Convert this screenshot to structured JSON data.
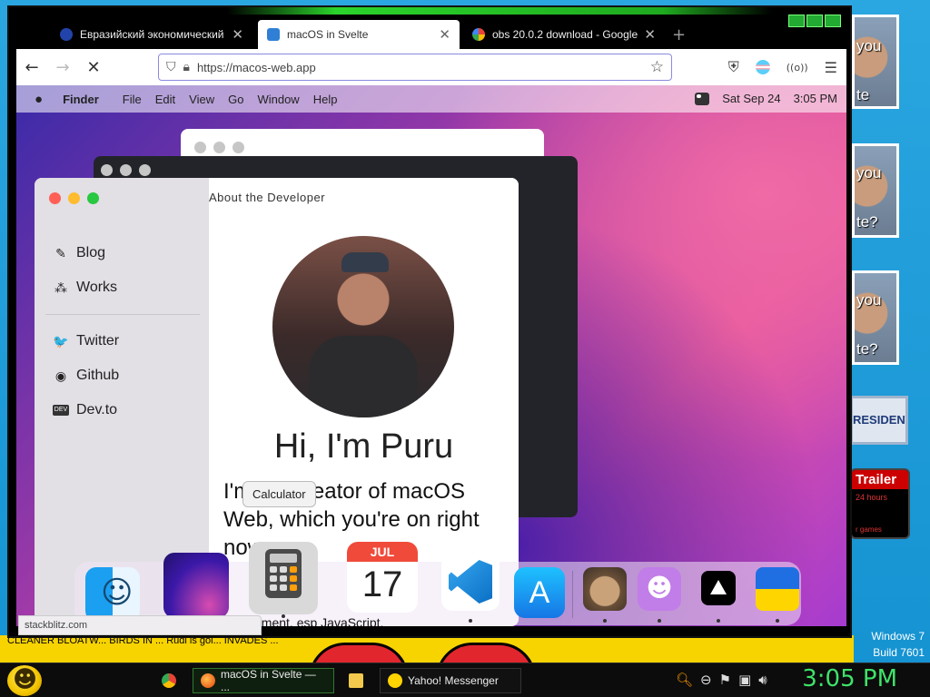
{
  "desktop": {
    "ads": [
      {
        "text": "you"
      },
      {
        "text": "you"
      },
      {
        "text": "you"
      }
    ],
    "ads_suffix": [
      "te",
      "te?",
      "te?"
    ],
    "president": "RESIDENT",
    "trailer": {
      "title": "Trailer",
      "line1": "24 hours",
      "line2": "r games"
    },
    "windows_label": "Windows 7",
    "build_label": "Build 7601",
    "strip_text": "CLEANER    BLOATW...    BIRDS IN ...    Rudi is gol...    INVADES ..."
  },
  "browser": {
    "tabs": [
      {
        "title": "Евразийский экономический",
        "favicon_color": "#2244aa",
        "close": "✕"
      },
      {
        "title": "macOS in Svelte",
        "favicon_color": "#2f7fd6",
        "close": "✕",
        "active": true
      },
      {
        "title": "obs 20.0.2 download - Google S",
        "favicon_color": "#4285f4",
        "close": "✕"
      }
    ],
    "new_tab": "+",
    "nav": {
      "back": "←",
      "forward": "→",
      "stop": "✕"
    },
    "url": "https://macos-web.app",
    "status_url": "stackblitz.com"
  },
  "macos": {
    "menubar": {
      "apple": "",
      "items": [
        "Finder",
        "File",
        "Edit",
        "View",
        "Go",
        "Window",
        "Help"
      ],
      "date": "Sat Sep 24",
      "time": "3:05 PM"
    },
    "about_window": {
      "heading": "About the Developer",
      "sidebar": [
        {
          "label": "Blog",
          "icon": "✎"
        },
        {
          "label": "Works",
          "icon": "⁂"
        },
        {
          "label": "Twitter",
          "icon": "🐦"
        },
        {
          "label": "Github",
          "icon": "◉"
        },
        {
          "label": "Dev.to",
          "icon": "DEV"
        }
      ],
      "greeting": "Hi, I'm Puru",
      "bio": "I'm the creator of macOS Web, which you're on right now",
      "bio_overflow": "pment, esp JavaScript,"
    },
    "tooltip": "Calculator",
    "dock": {
      "calendar_month": "JUL",
      "calendar_day": "17",
      "appstore_glyph": "A",
      "github_glyph": "☻"
    }
  },
  "taskbar": {
    "items": [
      {
        "label": "macOS in Svelte — ..."
      },
      {
        "label": "Yahoo! Messenger"
      }
    ],
    "clock": "3:05 PM"
  },
  "colors": {
    "traffic_red": "#ff5f57",
    "traffic_yellow": "#febc2e",
    "traffic_green": "#28c840",
    "inactive_dot": "#c6c6c6"
  }
}
